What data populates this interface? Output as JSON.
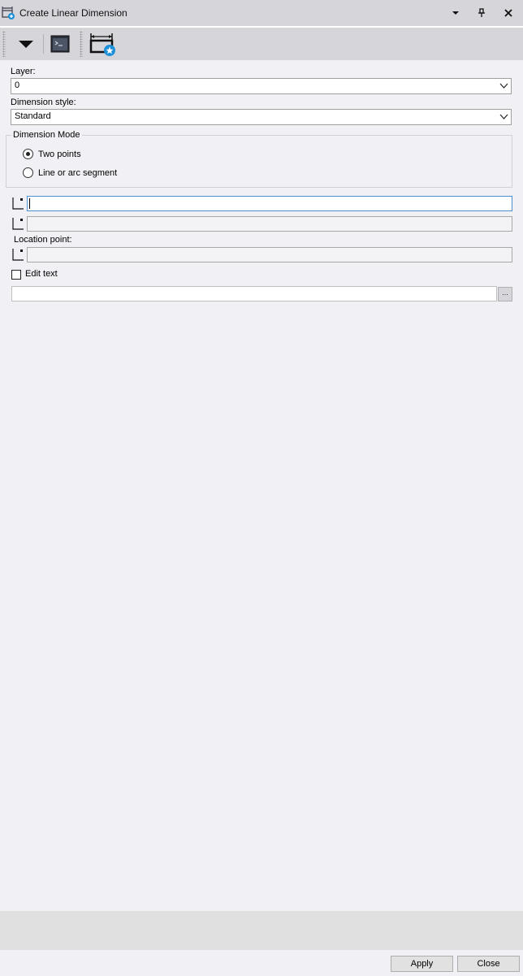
{
  "window": {
    "title": "Create Linear Dimension",
    "title_icon": "linear-dimension-icon",
    "menu_icon": "chevron-down-icon",
    "pin_icon": "pin-icon",
    "close_icon": "close-icon"
  },
  "toolbar": {
    "items": [
      {
        "icon": "dropdown-arrow-icon"
      },
      {
        "icon": "command-window-icon"
      },
      {
        "icon": "linear-dimension-new-icon"
      }
    ]
  },
  "form": {
    "layer_label": "Layer:",
    "layer_value": "0",
    "style_label": "Dimension style:",
    "style_value": "Standard",
    "mode_legend": "Dimension Mode",
    "mode_options": [
      {
        "label": "Two points",
        "checked": true
      },
      {
        "label": "Line or arc segment",
        "checked": false
      }
    ],
    "first_point_value": "",
    "second_point_value": "",
    "location_label": "Location point:",
    "location_value": "",
    "edit_text_label": "Edit text",
    "edit_text_checked": false,
    "text_value": "",
    "browse_label": "..."
  },
  "footer": {
    "apply_label": "Apply",
    "close_label": "Close"
  },
  "colors": {
    "titlebar": "#d5d5da",
    "panel": "#f0f0f5",
    "accent": "#1e90d8",
    "focus_border": "#4a8fd1"
  }
}
